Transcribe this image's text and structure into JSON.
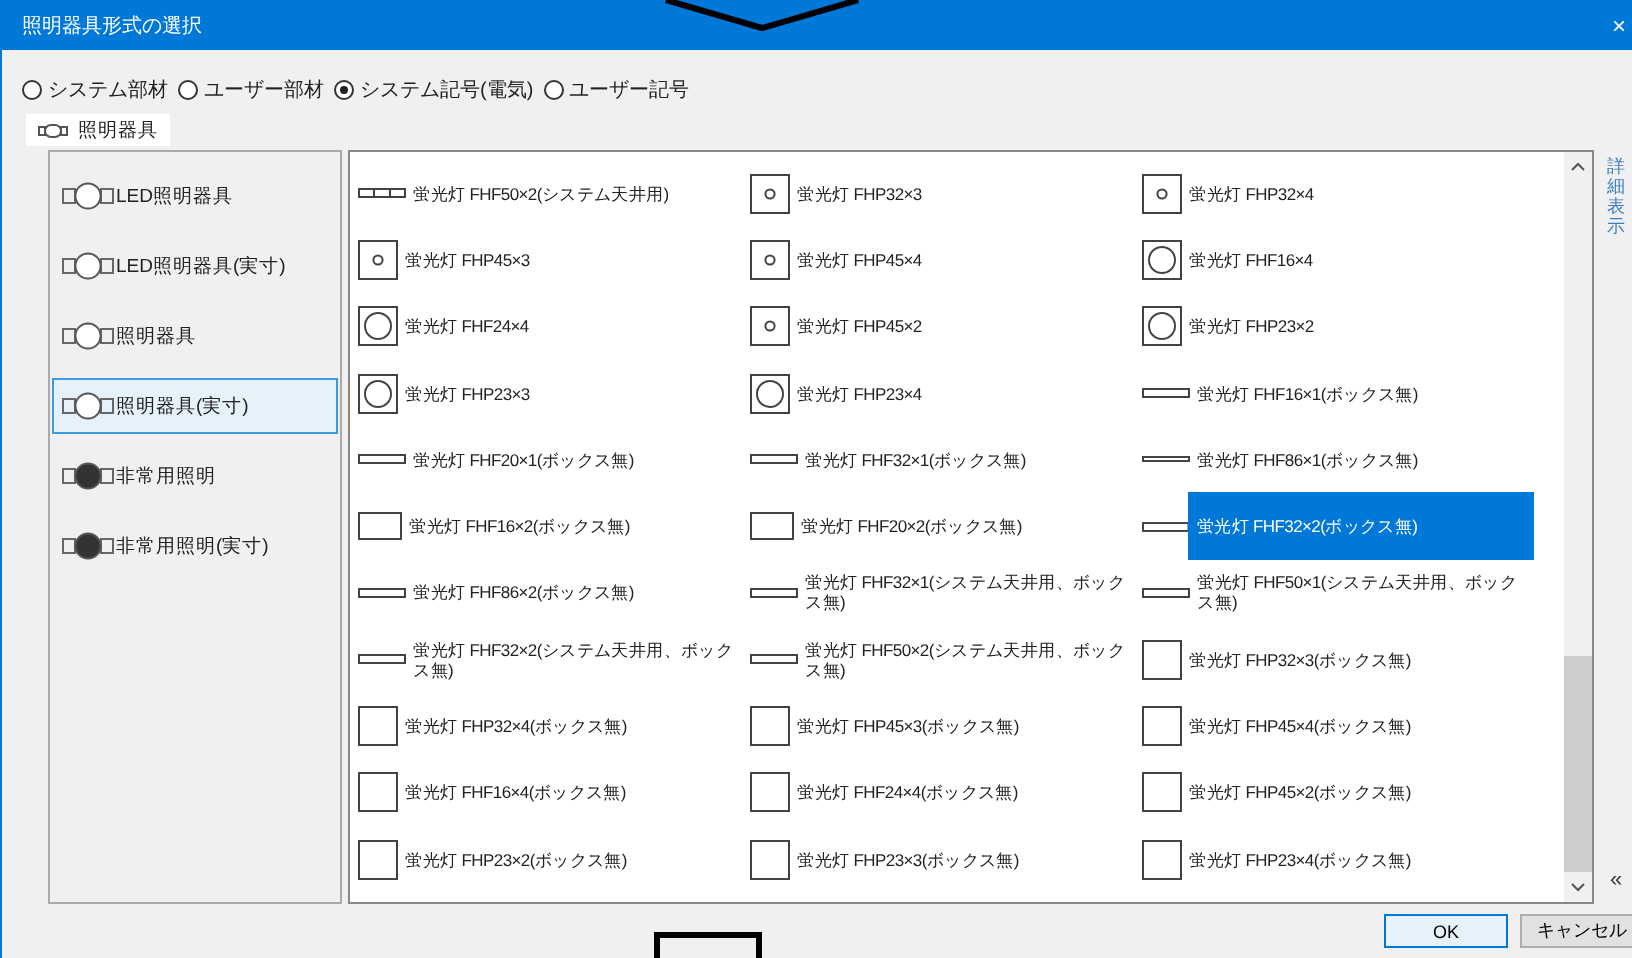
{
  "window": {
    "title": "照明器具形式の選択",
    "close": "×"
  },
  "source_options": [
    {
      "label": "システム部材",
      "selected": false
    },
    {
      "label": "ユーザー部材",
      "selected": false
    },
    {
      "label": "システム記号(電気)",
      "selected": true
    },
    {
      "label": "ユーザー記号",
      "selected": false
    }
  ],
  "tabs": [
    {
      "label": "照明器具",
      "selected": true
    }
  ],
  "categories": [
    {
      "label": "LED照明器具",
      "kind": "outline",
      "selected": false
    },
    {
      "label": "LED照明器具(実寸)",
      "kind": "outline",
      "selected": false
    },
    {
      "label": "照明器具",
      "kind": "outline",
      "selected": false
    },
    {
      "label": "照明器具(実寸)",
      "kind": "outline",
      "selected": true
    },
    {
      "label": "非常用照明",
      "kind": "filled",
      "selected": false
    },
    {
      "label": "非常用照明(実寸)",
      "kind": "filled",
      "selected": false
    }
  ],
  "fixtures": [
    {
      "label": "蛍光灯 FHF50×2(システム天井用)",
      "kind": "system",
      "selected": false
    },
    {
      "label": "蛍光灯 FHP32×3",
      "kind": "box-dot",
      "selected": false
    },
    {
      "label": "蛍光灯 FHP32×4",
      "kind": "box-dot",
      "selected": false
    },
    {
      "label": "蛍光灯 FHP45×3",
      "kind": "box-dot",
      "selected": false
    },
    {
      "label": "蛍光灯 FHP45×4",
      "kind": "box-dot",
      "selected": false
    },
    {
      "label": "蛍光灯 FHF16×4",
      "kind": "box-circle",
      "selected": false
    },
    {
      "label": "蛍光灯 FHF24×4",
      "kind": "box-circle",
      "selected": false
    },
    {
      "label": "蛍光灯 FHP45×2",
      "kind": "box-dot",
      "selected": false
    },
    {
      "label": "蛍光灯 FHP23×2",
      "kind": "box-circle",
      "selected": false
    },
    {
      "label": "蛍光灯 FHP23×3",
      "kind": "box-circle",
      "selected": false
    },
    {
      "label": "蛍光灯 FHP23×4",
      "kind": "box-circle",
      "selected": false
    },
    {
      "label": "蛍光灯 FHF16×1(ボックス無)",
      "kind": "bar",
      "selected": false
    },
    {
      "label": "蛍光灯 FHF20×1(ボックス無)",
      "kind": "bar",
      "selected": false
    },
    {
      "label": "蛍光灯 FHF32×1(ボックス無)",
      "kind": "bar",
      "selected": false
    },
    {
      "label": "蛍光灯 FHF86×1(ボックス無)",
      "kind": "line",
      "selected": false
    },
    {
      "label": "蛍光灯 FHF16×2(ボックス無)",
      "kind": "rect",
      "selected": false
    },
    {
      "label": "蛍光灯 FHF20×2(ボックス無)",
      "kind": "rect",
      "selected": false
    },
    {
      "label": "蛍光灯 FHF32×2(ボックス無)",
      "kind": "bar",
      "selected": true
    },
    {
      "label": "蛍光灯 FHF86×2(ボックス無)",
      "kind": "bar",
      "selected": false
    },
    {
      "label": "蛍光灯 FHF32×1(システム天井用、ボックス無)",
      "kind": "bar",
      "selected": false
    },
    {
      "label": "蛍光灯 FHF50×1(システム天井用、ボックス無)",
      "kind": "bar",
      "selected": false
    },
    {
      "label": "蛍光灯 FHF32×2(システム天井用、ボックス無)",
      "kind": "bar",
      "selected": false
    },
    {
      "label": "蛍光灯 FHF50×2(システム天井用、ボックス無)",
      "kind": "bar",
      "selected": false
    },
    {
      "label": "蛍光灯 FHP32×3(ボックス無)",
      "kind": "box",
      "selected": false
    },
    {
      "label": "蛍光灯 FHP32×4(ボックス無)",
      "kind": "box",
      "selected": false
    },
    {
      "label": "蛍光灯 FHP45×3(ボックス無)",
      "kind": "box",
      "selected": false
    },
    {
      "label": "蛍光灯 FHP45×4(ボックス無)",
      "kind": "box",
      "selected": false
    },
    {
      "label": "蛍光灯 FHF16×4(ボックス無)",
      "kind": "box",
      "selected": false
    },
    {
      "label": "蛍光灯 FHF24×4(ボックス無)",
      "kind": "box",
      "selected": false
    },
    {
      "label": "蛍光灯 FHP45×2(ボックス無)",
      "kind": "box",
      "selected": false
    },
    {
      "label": "蛍光灯 FHP23×2(ボックス無)",
      "kind": "box",
      "selected": false
    },
    {
      "label": "蛍光灯 FHP23×3(ボックス無)",
      "kind": "box",
      "selected": false
    },
    {
      "label": "蛍光灯 FHP23×4(ボックス無)",
      "kind": "box",
      "selected": false
    }
  ],
  "side_panel": {
    "label": "詳細表示",
    "collapse": "«"
  },
  "buttons": [
    {
      "label": "OK",
      "kind": "default"
    },
    {
      "label": "キャンセル",
      "kind": "normal"
    }
  ]
}
